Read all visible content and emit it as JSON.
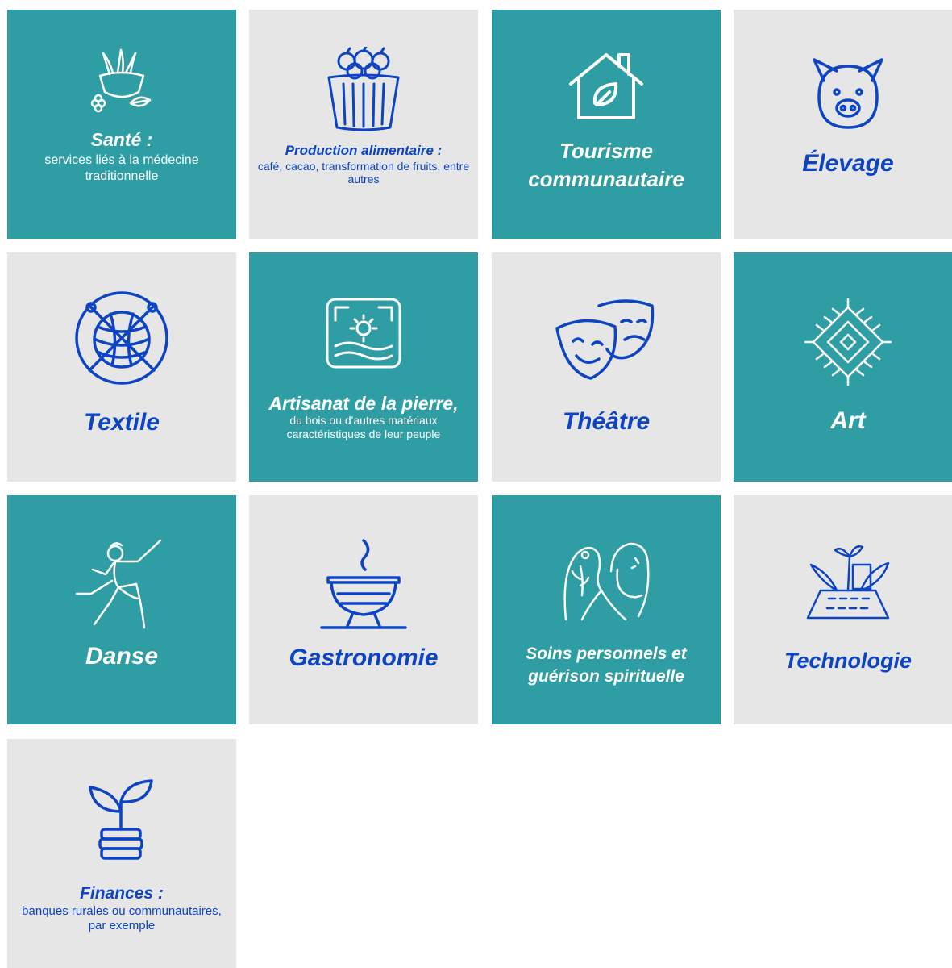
{
  "colors": {
    "teal": "#2f9ea4",
    "grey": "#e6e6e7",
    "blue": "#0d44c4",
    "white": "#ffffff"
  },
  "tiles": [
    {
      "title": "Santé :",
      "desc": "services liés à la médecine traditionnelle",
      "icon": "mortar-herbs-icon"
    },
    {
      "title": "Production alimentaire :",
      "desc": "café, cacao, transformation de fruits, entre autres",
      "icon": "fruit-basket-icon"
    },
    {
      "title": "Tourisme communautaire",
      "icon": "house-leaf-icon"
    },
    {
      "title": "Élevage",
      "icon": "pig-icon"
    },
    {
      "title": "Textile",
      "icon": "yarn-ball-icon"
    },
    {
      "title": "Artisanat de la pierre,",
      "desc": "du bois ou d'autres matériaux caractéristiques de leur peuple",
      "icon": "landscape-frame-icon"
    },
    {
      "title": "Théâtre",
      "icon": "theatre-masks-icon"
    },
    {
      "title": "Art",
      "icon": "diamond-pattern-icon"
    },
    {
      "title": "Danse",
      "icon": "dancer-icon"
    },
    {
      "title": "Gastronomie",
      "icon": "steaming-bowl-icon"
    },
    {
      "title": "Soins personnels et guérison spirituelle",
      "icon": "two-faces-icon"
    },
    {
      "title": "Technologie",
      "icon": "laptop-plant-icon"
    },
    {
      "title": "Finances :",
      "desc": "banques rurales ou communautaires, par exemple",
      "icon": "coin-plant-icon"
    }
  ]
}
